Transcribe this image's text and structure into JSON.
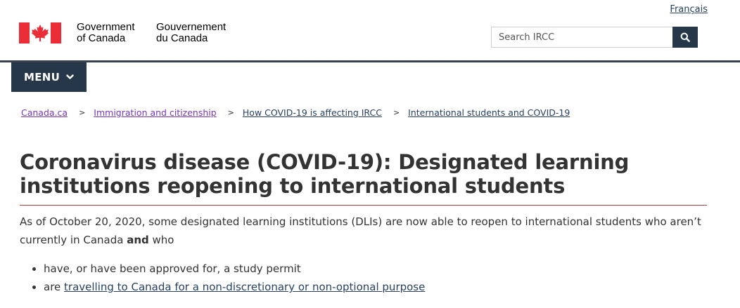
{
  "header": {
    "language_link": "Français",
    "brand_en": [
      "Government",
      "of Canada"
    ],
    "brand_fr": [
      "Gouvernement",
      "du Canada"
    ],
    "search_placeholder": "Search IRCC",
    "search_icon": "magnifier-icon",
    "menu_label": "MENU",
    "menu_icon": "chevron-down-icon",
    "colors": {
      "accent": "#26374a",
      "flag_red": "#eb2d37",
      "title_rule": "#af3c43",
      "link": "#284162",
      "visited": "#7834bc"
    }
  },
  "breadcrumb": [
    {
      "label": "Canada.ca"
    },
    {
      "label": "Immigration and citizenship"
    },
    {
      "label": "How COVID-19 is affecting IRCC"
    },
    {
      "label": "International students and COVID-19"
    }
  ],
  "main": {
    "title": "Coronavirus disease (COVID-19): Designated learning institutions reopening to international students",
    "intro_before": "As of October 20, 2020, some designated learning institutions (DLIs) are now able to reopen to international students who aren’t currently in Canada ",
    "intro_bold": "and",
    "intro_after": " who",
    "bullet_1": "have, or have been approved for, a study permit",
    "bullet_2_prefix": "are ",
    "bullet_2_link": "travelling to Canada for a non-discretionary or non-optional purpose"
  }
}
